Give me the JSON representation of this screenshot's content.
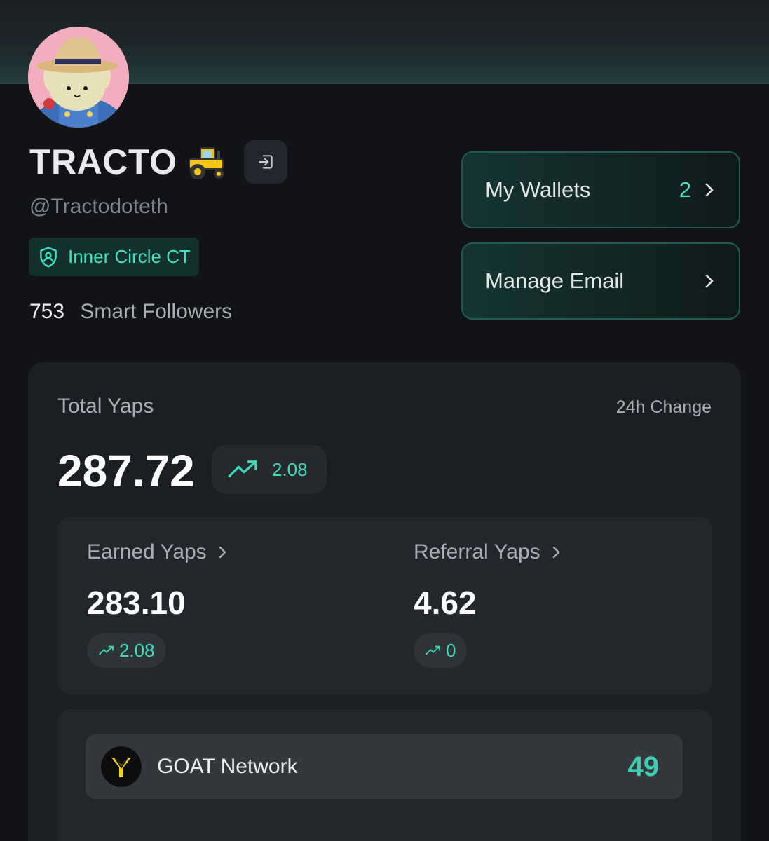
{
  "profile": {
    "display_name": "TRACTO",
    "handle": "@Tractodoteth",
    "badge": "Inner Circle CT",
    "smart_followers_count": "753",
    "smart_followers_label": "Smart Followers"
  },
  "actions": {
    "wallets_label": "My Wallets",
    "wallets_count": "2",
    "email_label": "Manage Email"
  },
  "yaps": {
    "total_label": "Total Yaps",
    "change_label": "24h Change",
    "total_value": "287.72",
    "total_change": "2.08",
    "earned_label": "Earned Yaps",
    "earned_value": "283.10",
    "earned_change": "2.08",
    "referral_label": "Referral Yaps",
    "referral_value": "4.62",
    "referral_change": "0"
  },
  "projects": [
    {
      "name": "GOAT Network",
      "score": "49"
    }
  ],
  "colors": {
    "accent": "#3dd9bb",
    "background": "#111317",
    "card": "#1b1e22"
  },
  "icons": [
    "tractor-icon",
    "logout-icon",
    "shield-user-icon",
    "chevron-right-icon",
    "trending-up-icon",
    "goat-logo-icon"
  ]
}
